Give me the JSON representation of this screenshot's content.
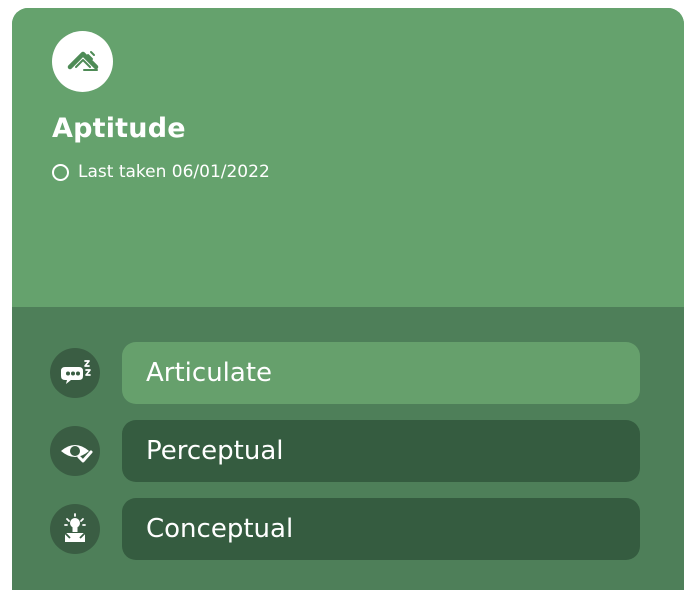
{
  "card": {
    "title": "Aptitude",
    "last_taken": "Last taken 06/01/2022",
    "logo_icon": "chevron-ruler-icon",
    "status_icon": "empty-circle-icon"
  },
  "categories": [
    {
      "label": "Articulate",
      "icon": "speech-bubble-z-icon",
      "selected": true
    },
    {
      "label": "Perceptual",
      "icon": "eye-check-icon",
      "selected": false
    },
    {
      "label": "Conceptual",
      "icon": "lightbulb-box-icon",
      "selected": false
    }
  ],
  "colors": {
    "card_top": "#65a26d",
    "card_bottom": "#4e7f59",
    "pill_active": "#66a06c",
    "pill_default": "#355c40",
    "icon_circle": "#3a5d43",
    "text": "#ffffff"
  }
}
